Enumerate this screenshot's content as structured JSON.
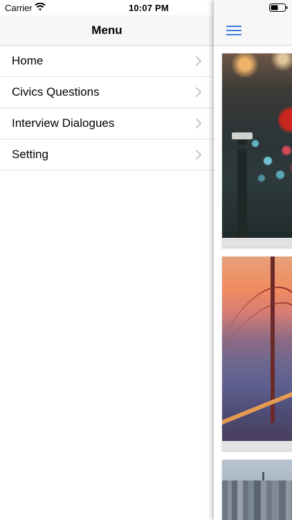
{
  "status_bar": {
    "carrier": "Carrier",
    "time": "10:07 PM"
  },
  "menu": {
    "title": "Menu",
    "items": [
      {
        "label": "Home"
      },
      {
        "label": "Civics Questions"
      },
      {
        "label": "Interview Dialogues"
      },
      {
        "label": "Setting"
      }
    ]
  },
  "content": {
    "cards": [
      {
        "image": "night-street-flowers-photo"
      },
      {
        "image": "golden-gate-bridge-sunset-photo"
      },
      {
        "image": "city-skyline-photo"
      }
    ]
  },
  "colors": {
    "nav_background": "#f7f7f7",
    "accent": "#3d7bd9",
    "separator": "#e2e2e2",
    "chevron": "#c7c7cc"
  }
}
